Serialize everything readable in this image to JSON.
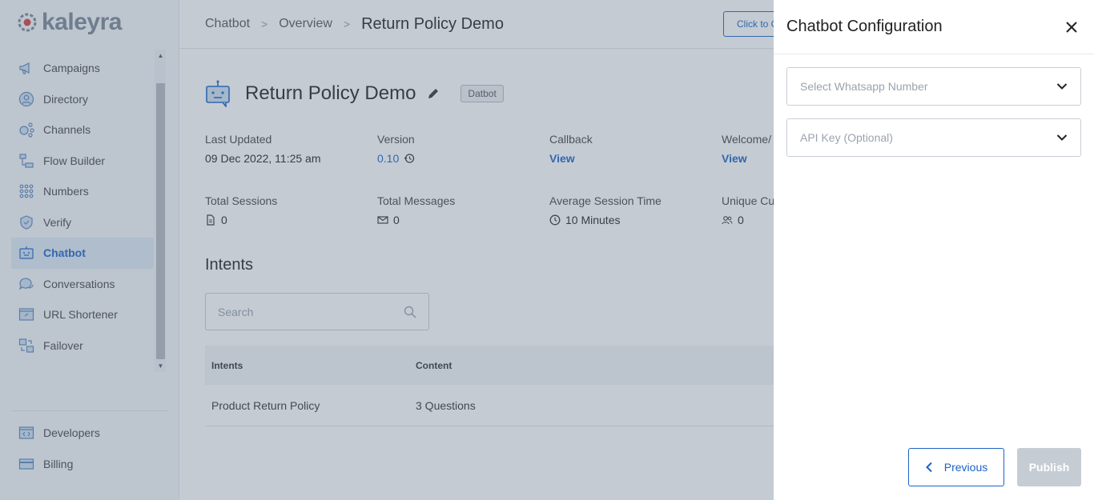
{
  "brand": {
    "name": "kaleyra"
  },
  "sidebar": {
    "items": [
      {
        "label": "Campaigns",
        "icon": "megaphone-icon"
      },
      {
        "label": "Directory",
        "icon": "user-circle-icon"
      },
      {
        "label": "Channels",
        "icon": "channels-icon"
      },
      {
        "label": "Flow Builder",
        "icon": "flow-icon"
      },
      {
        "label": "Numbers",
        "icon": "dialpad-icon"
      },
      {
        "label": "Verify",
        "icon": "shield-check-icon"
      },
      {
        "label": "Chatbot",
        "icon": "robot-icon",
        "active": true
      },
      {
        "label": "Conversations",
        "icon": "chat-bubbles-icon"
      },
      {
        "label": "URL Shortener",
        "icon": "link-icon"
      },
      {
        "label": "Failover",
        "icon": "failover-icon"
      }
    ],
    "bottom_items": [
      {
        "label": "Developers",
        "icon": "code-icon"
      },
      {
        "label": "Billing",
        "icon": "card-icon"
      }
    ]
  },
  "breadcrumb": {
    "items": [
      "Chatbot",
      "Overview"
    ],
    "current": "Return Policy Demo"
  },
  "header_cta": "Click to C",
  "bot": {
    "title": "Return Policy Demo",
    "badge": "Datbot",
    "stats": [
      {
        "label": "Last Updated",
        "value": "09 Dec 2022, 11:25 am"
      },
      {
        "label": "Version",
        "value": "0.10"
      },
      {
        "label": "Callback",
        "value": "View"
      },
      {
        "label": "Welcome/",
        "value": "View"
      },
      {
        "label": "Total Sessions",
        "value": "0"
      },
      {
        "label": "Total Messages",
        "value": "0"
      },
      {
        "label": "Average Session Time",
        "value": "10 Minutes"
      },
      {
        "label": "Unique Cu",
        "value": "0"
      }
    ]
  },
  "intents": {
    "title": "Intents",
    "search_placeholder": "Search",
    "columns": [
      "Intents",
      "Content"
    ],
    "rows": [
      {
        "intent": "Product Return Policy",
        "content": "3 Questions"
      }
    ]
  },
  "drawer": {
    "title": "Chatbot Configuration",
    "select_number_placeholder": "Select Whatsapp Number",
    "api_key_placeholder": "API Key (Optional)",
    "previous_label": "Previous",
    "publish_label": "Publish"
  },
  "colors": {
    "accent": "#1b63c6",
    "sidebar_bg": "#f4f6f9",
    "overlay": "#5c7085"
  }
}
